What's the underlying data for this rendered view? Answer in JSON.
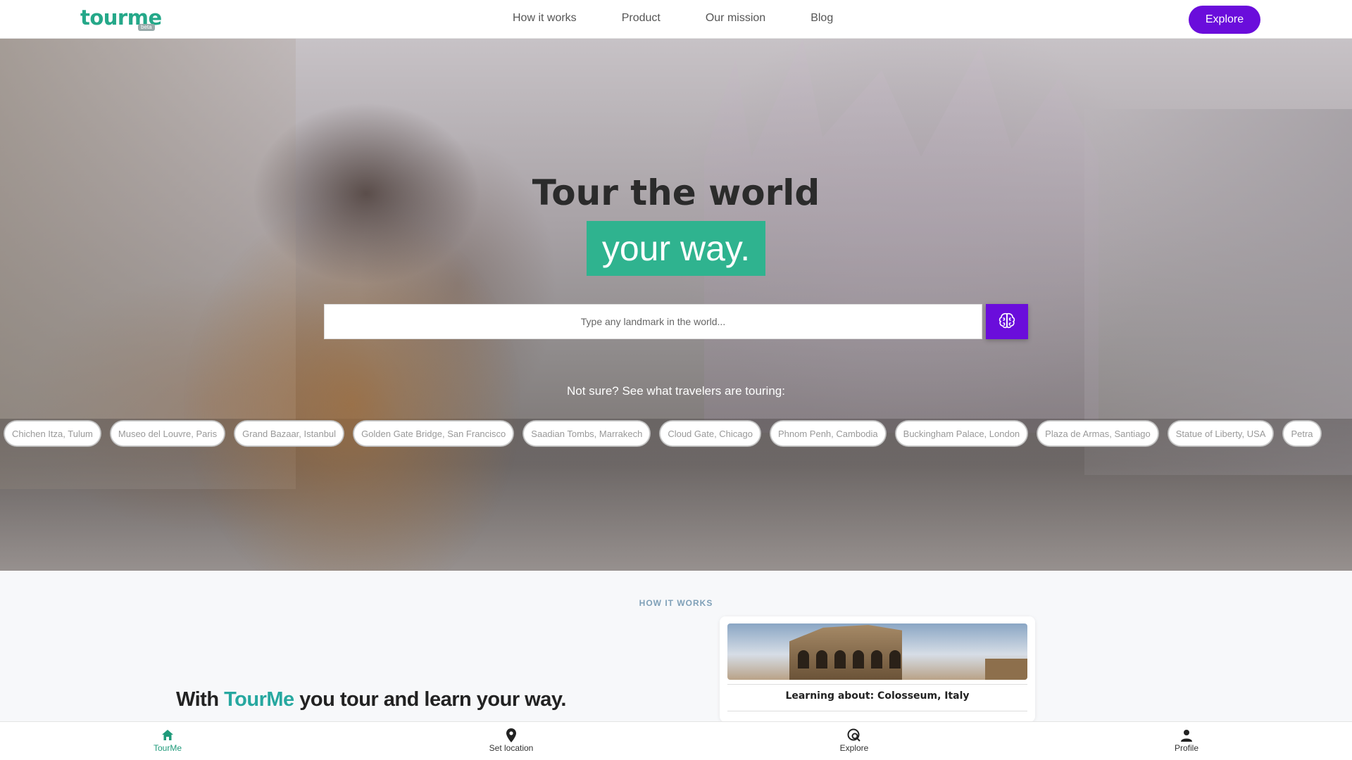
{
  "header": {
    "logo": "tourme",
    "logo_badge": "beta",
    "nav": [
      "How it works",
      "Product",
      "Our mission",
      "Blog"
    ],
    "explore_label": "Explore"
  },
  "hero": {
    "title_line1": "Tour the world",
    "title_line2": "your way.",
    "search_placeholder": "Type any landmark in the world...",
    "prompt": "Not sure? See what travelers are touring:",
    "chips": [
      "Chichen Itza, Tulum",
      "Museo del Louvre, Paris",
      "Grand Bazaar, Istanbul",
      "Golden Gate Bridge, San Francisco",
      "Saadian Tombs, Marrakech",
      "Cloud Gate, Chicago",
      "Phnom Penh, Cambodia",
      "Buckingham Palace, London",
      "Plaza de Armas, Santiago",
      "Statue of Liberty, USA",
      "Petra"
    ]
  },
  "how_it_works": {
    "label": "HOW IT WORKS",
    "heading_pre": "With ",
    "heading_accent": "TourMe",
    "heading_post": " you tour and learn your way.",
    "card_title": "Learning about: Colosseum, Italy"
  },
  "bottom_nav": [
    {
      "label": "TourMe",
      "icon": "home-icon"
    },
    {
      "label": "Set location",
      "icon": "location-pin-icon"
    },
    {
      "label": "Explore",
      "icon": "explore-search-icon"
    },
    {
      "label": "Profile",
      "icon": "person-icon"
    }
  ],
  "colors": {
    "brand_green": "#25a889",
    "accent_purple": "#6a0ddb",
    "highlight_teal": "#2fb38f"
  }
}
